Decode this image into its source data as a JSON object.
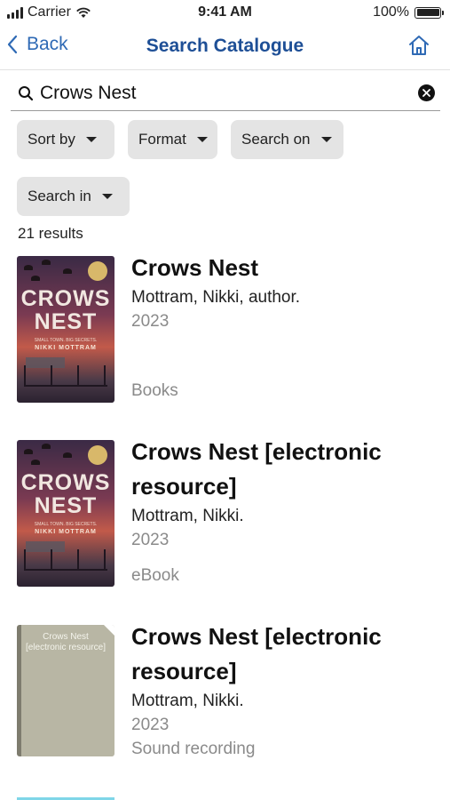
{
  "status_bar": {
    "carrier": "Carrier",
    "time": "9:41 AM",
    "battery": "100%"
  },
  "nav": {
    "back_label": "Back",
    "title": "Search Catalogue"
  },
  "search": {
    "query": "Crows Nest"
  },
  "filters": {
    "sort_by": "Sort by",
    "format": "Format",
    "search_on": "Search on",
    "search_in": "Search in"
  },
  "result_count": "21 results",
  "results": [
    {
      "title": "Crows Nest",
      "author": "Mottram, Nikki, author.",
      "year": "2023",
      "format": "Books",
      "cover_words": [
        "CROWS",
        "NEST"
      ],
      "cover_tagline": "SMALL TOWN. BIG SECRETS.",
      "cover_author": "NIKKI MOTTRAM"
    },
    {
      "title": "Crows Nest [electronic resource]",
      "author": "Mottram, Nikki.",
      "year": "2023",
      "format": "eBook",
      "cover_words": [
        "CROWS",
        "NEST"
      ],
      "cover_tagline": "SMALL TOWN. BIG SECRETS.",
      "cover_author": "NIKKI MOTTRAM"
    },
    {
      "title": "Crows Nest [electronic resource]",
      "author": "Mottram, Nikki.",
      "year": "2023",
      "format": "Sound recording",
      "cover_label": "Crows Nest [electronic resource]"
    }
  ]
}
